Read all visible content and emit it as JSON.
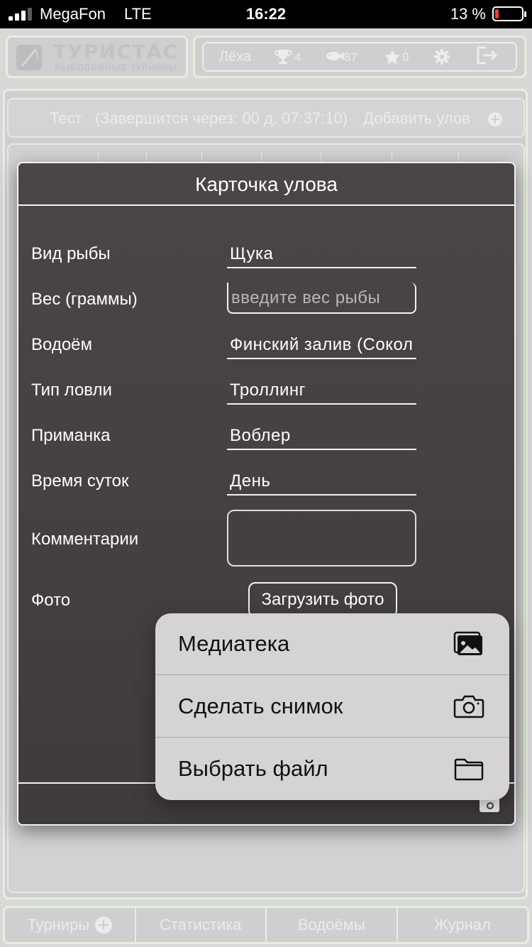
{
  "status_bar": {
    "carrier": "MegaFon",
    "network": "LTE",
    "time": "16:22",
    "battery_percent": "13 %"
  },
  "header": {
    "logo_title": "ТУРИСТАС",
    "logo_subtitle": "РЫБОЛОВНЫЕ ТУРНИРЫ",
    "user_name": "Лёха",
    "trophies": "4",
    "fish_count": "87",
    "stars": "0"
  },
  "tournament_bar": {
    "name": "Тест",
    "countdown": "(Завершится через: 00 д. 07:37:10)",
    "add_catch_label": "Добавить улов"
  },
  "catch_card": {
    "title": "Карточка улова",
    "rows": [
      {
        "label": "Вид рыбы",
        "value": "Щука"
      },
      {
        "label": "Вес (граммы)",
        "placeholder": "введите вес рыбы"
      },
      {
        "label": "Водоём",
        "value": "Финский залив (Сокол"
      },
      {
        "label": "Тип ловли",
        "value": "Троллинг"
      },
      {
        "label": "Приманка",
        "value": "Воблер"
      },
      {
        "label": "Время суток",
        "value": "День"
      },
      {
        "label": "Комментарии",
        "value": ""
      },
      {
        "label": "Фото"
      }
    ],
    "upload_photo_label": "Загрузить фото"
  },
  "photo_menu": {
    "items": [
      {
        "label": "Медиатека",
        "icon": "photo-library-icon"
      },
      {
        "label": "Сделать снимок",
        "icon": "camera-icon"
      },
      {
        "label": "Выбрать файл",
        "icon": "folder-icon"
      }
    ]
  },
  "bottom_nav": {
    "tabs": [
      {
        "label": "Турниры"
      },
      {
        "label": "Статистика"
      },
      {
        "label": "Водоёмы"
      },
      {
        "label": "Журнал"
      }
    ]
  },
  "colors": {
    "accent_border": "#e3f0dc",
    "modal_bg": "#4a4646",
    "menu_bg": "#d5d3d3",
    "battery_low": "#ff3b30"
  }
}
